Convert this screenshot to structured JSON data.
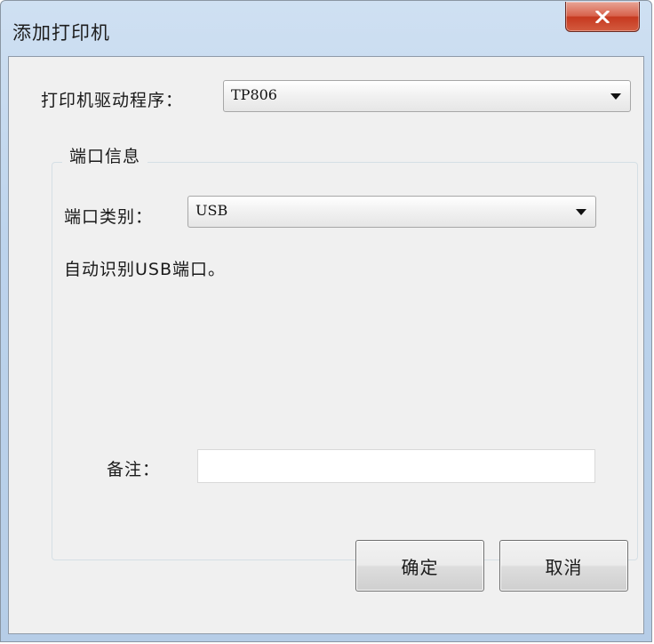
{
  "window": {
    "title": "添加打印机",
    "close_label": "x"
  },
  "driver": {
    "label": "打印机驱动程序：",
    "selected": "TP806"
  },
  "port_group": {
    "legend": "端口信息",
    "type_label": "端口类别：",
    "type_selected": "USB",
    "info_text": "自动识别USB端口。",
    "note_label": "备注：",
    "note_value": ""
  },
  "buttons": {
    "ok": "确定",
    "cancel": "取消"
  },
  "colors": {
    "frame": "#bcd3ec",
    "client_bg": "#f0f0f0",
    "close_red": "#c6391f"
  }
}
